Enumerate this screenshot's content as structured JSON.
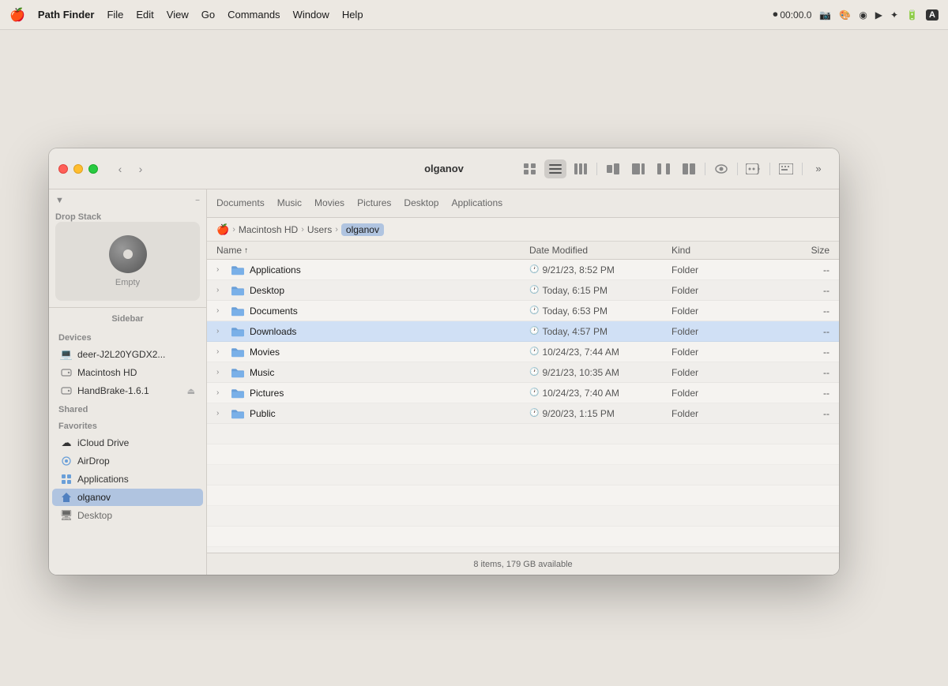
{
  "menubar": {
    "apple": "🍎",
    "app_name": "Path Finder",
    "menus": [
      "File",
      "Edit",
      "View",
      "Go",
      "Commands",
      "Window",
      "Help"
    ],
    "status": {
      "record": "⏺",
      "time": "00:00.0",
      "bluetooth": "🔵",
      "battery": "🔋"
    }
  },
  "window": {
    "title": "olganov",
    "nav": {
      "back": "‹",
      "forward": "›"
    }
  },
  "toolbar": {
    "views": [
      "grid",
      "list",
      "columns",
      "cover",
      "preview1",
      "preview2",
      "dual"
    ],
    "eye": "👁",
    "action": "⚙"
  },
  "drop_stack": {
    "label": "Drop Stack",
    "empty_label": "Empty"
  },
  "sidebar": {
    "label": "Sidebar",
    "sections": {
      "devices": {
        "label": "Devices",
        "items": [
          {
            "id": "deer",
            "name": "deer-J2L20YGDX2...",
            "icon": "💻"
          },
          {
            "id": "macintosh-hd",
            "name": "Macintosh HD",
            "icon": "💿"
          },
          {
            "id": "handbrake",
            "name": "HandBrake-1.6.1",
            "icon": "💿",
            "eject": true
          }
        ]
      },
      "shared": {
        "label": "Shared",
        "items": []
      },
      "favorites": {
        "label": "Favorites",
        "items": [
          {
            "id": "icloud",
            "name": "iCloud Drive",
            "icon": "☁"
          },
          {
            "id": "airdrop",
            "name": "AirDrop",
            "icon": "📡"
          },
          {
            "id": "applications",
            "name": "Applications",
            "icon": "📁"
          },
          {
            "id": "olganov",
            "name": "olganov",
            "icon": "🏠",
            "selected": true
          }
        ]
      }
    }
  },
  "location_tabs": [
    "Documents",
    "Music",
    "Movies",
    "Pictures",
    "Desktop",
    "Applications"
  ],
  "breadcrumb": [
    {
      "id": "apple",
      "label": "🍎",
      "is_icon": true
    },
    {
      "id": "macintosh-hd",
      "label": "Macintosh HD"
    },
    {
      "id": "users",
      "label": "Users"
    },
    {
      "id": "olganov",
      "label": "olganov",
      "current": true
    }
  ],
  "file_list": {
    "columns": {
      "name": "Name",
      "date_modified": "Date Modified",
      "kind": "Kind",
      "size": "Size"
    },
    "sort_col": "name",
    "sort_dir": "asc",
    "rows": [
      {
        "name": "Applications",
        "date": "9/21/23, 8:52 PM",
        "kind": "Folder",
        "size": "--",
        "selected": false
      },
      {
        "name": "Desktop",
        "date": "Today, 6:15 PM",
        "kind": "Folder",
        "size": "--",
        "selected": false
      },
      {
        "name": "Documents",
        "date": "Today, 6:53 PM",
        "kind": "Folder",
        "size": "--",
        "selected": false
      },
      {
        "name": "Downloads",
        "date": "Today, 4:57 PM",
        "kind": "Folder",
        "size": "--",
        "selected": true
      },
      {
        "name": "Movies",
        "date": "10/24/23, 7:44 AM",
        "kind": "Folder",
        "size": "--",
        "selected": false
      },
      {
        "name": "Music",
        "date": "9/21/23, 10:35 AM",
        "kind": "Folder",
        "size": "--",
        "selected": false
      },
      {
        "name": "Pictures",
        "date": "10/24/23, 7:40 AM",
        "kind": "Folder",
        "size": "--",
        "selected": false
      },
      {
        "name": "Public",
        "date": "9/20/23, 1:15 PM",
        "kind": "Folder",
        "size": "--",
        "selected": false
      }
    ],
    "empty_rows": 8
  },
  "status_bar": {
    "text": "8 items, 179 GB available"
  }
}
